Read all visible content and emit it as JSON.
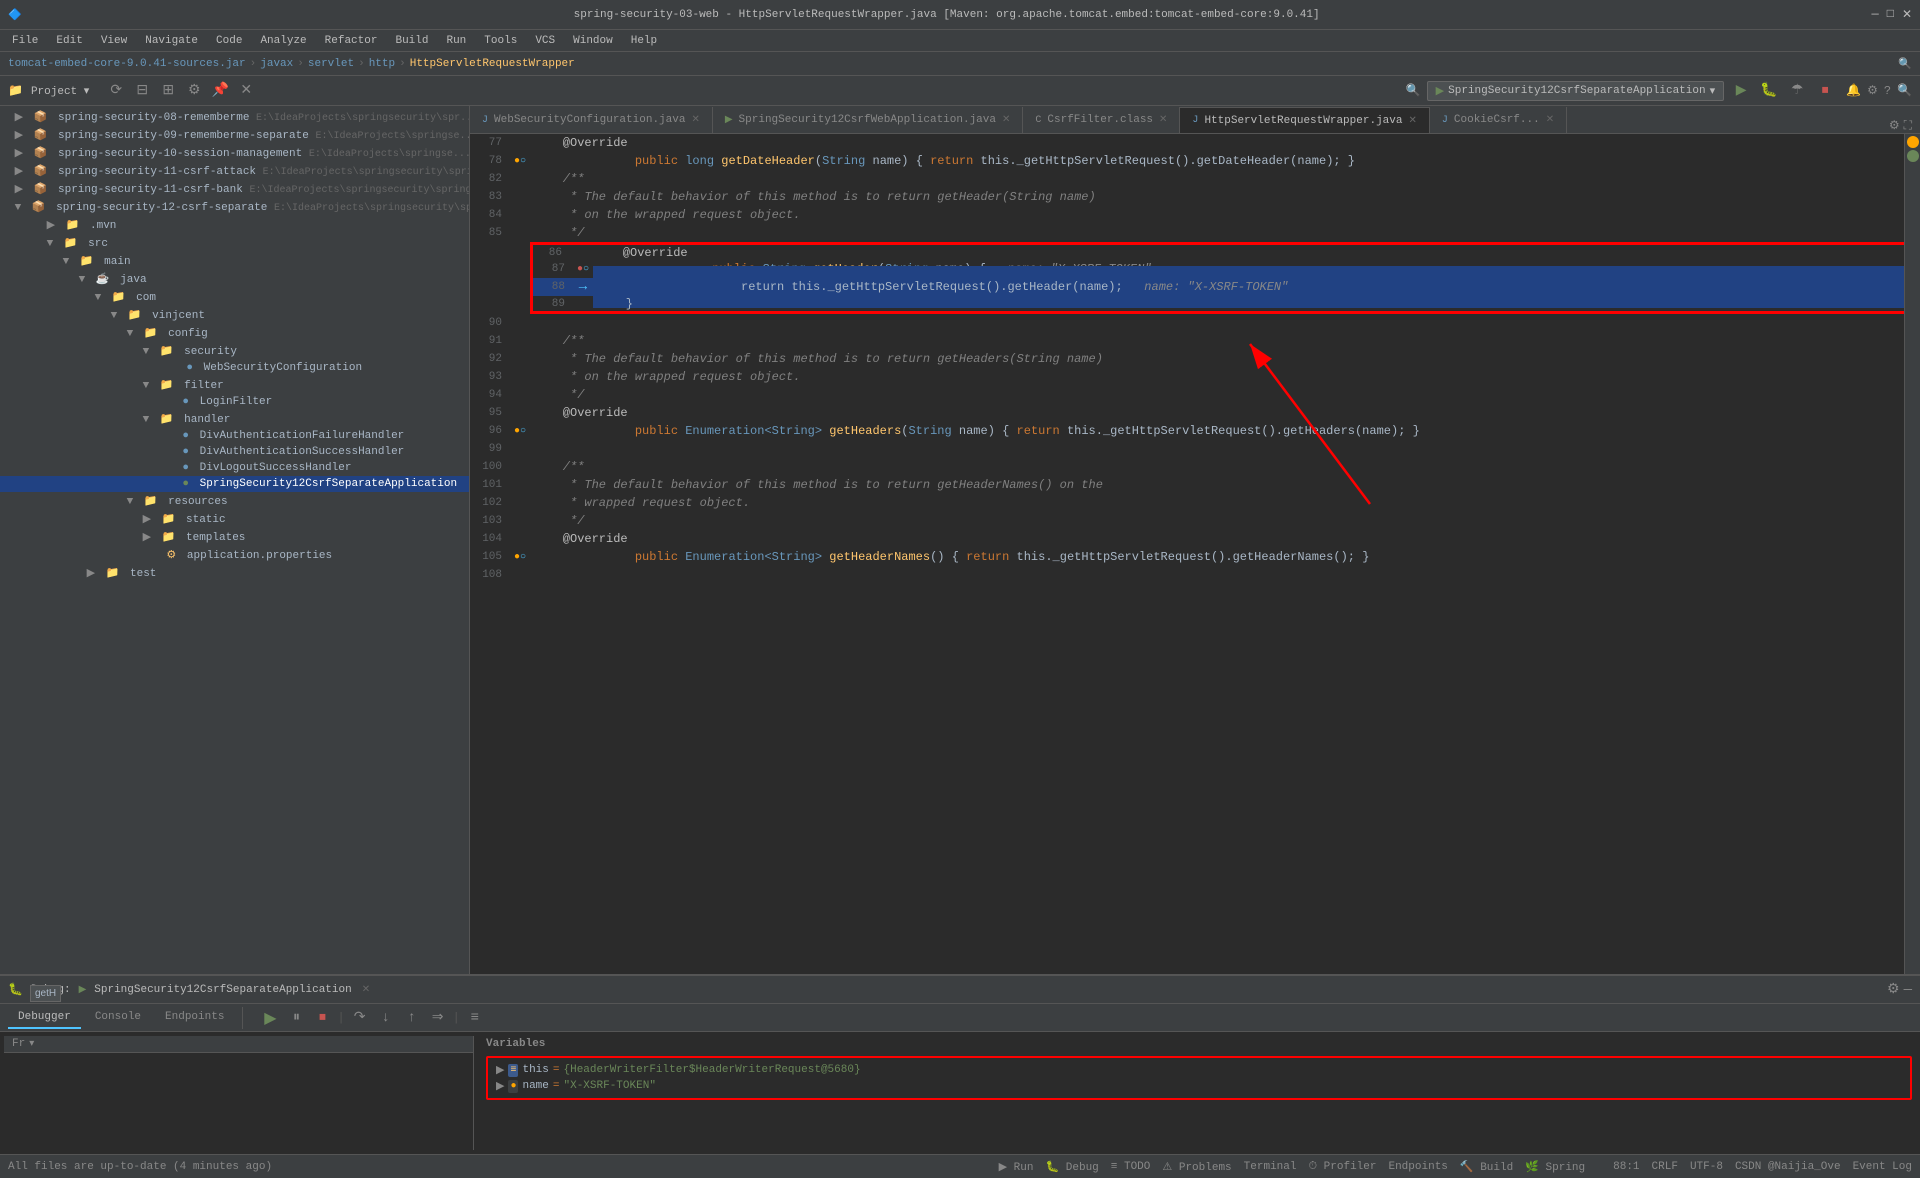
{
  "titlebar": {
    "title": "spring-security-03-web - HttpServletRequestWrapper.java [Maven: org.apache.tomcat.embed:tomcat-embed-core:9.0.41]",
    "controls": [
      "—",
      "□",
      "✕"
    ]
  },
  "menubar": {
    "items": [
      "File",
      "Edit",
      "View",
      "Navigate",
      "Code",
      "Analyze",
      "Refactor",
      "Build",
      "Run",
      "Tools",
      "VCS",
      "Window",
      "Help"
    ]
  },
  "breadcrumb": {
    "items": [
      "tomcat-embed-core-9.0.41-sources.jar",
      "javax",
      "servlet",
      "http",
      "HttpServletRequestWrapper"
    ]
  },
  "run_config": {
    "name": "SpringSecurity12CsrfSeparateApplication",
    "label": "SpringSecurity12CsrfSeparateApplication"
  },
  "editor_tabs": [
    {
      "label": "WebSecurityConfiguration.java",
      "active": false
    },
    {
      "label": "SpringSecurity12CsrfWebApplication.java",
      "active": false
    },
    {
      "label": "CsrfFilter.class",
      "active": false
    },
    {
      "label": "HttpServletRequestWrapper.java",
      "active": true
    },
    {
      "label": "CookieCsrf...",
      "active": false
    }
  ],
  "code_lines": [
    {
      "num": 77,
      "content": "    @Override",
      "type": "annotation"
    },
    {
      "num": 78,
      "content": "    public long getDateHeader(String name) { return this._getHttpServletRequest().getDateHeader(name); }",
      "type": "normal",
      "has_debug": true
    },
    {
      "num": 82,
      "content": "    /**",
      "type": "comment"
    },
    {
      "num": 83,
      "content": "     * The default behavior of this method is to return getHeader(String name)",
      "type": "comment"
    },
    {
      "num": 84,
      "content": "     * on the wrapped request object.",
      "type": "comment"
    },
    {
      "num": 85,
      "content": "     */",
      "type": "comment"
    },
    {
      "num": 86,
      "content": "    @Override",
      "type": "annotation"
    },
    {
      "num": 87,
      "content": "    public String getHeader(String name) {   name: \"X-XSRF-TOKEN\"",
      "type": "normal",
      "has_debug": true,
      "has_breakpoint": true
    },
    {
      "num": 88,
      "content": "        return this._getHttpServletRequest().getHeader(name);   name: \"X-XSRF-TOKEN\"",
      "type": "normal",
      "highlighted": true,
      "has_debug": true
    },
    {
      "num": 89,
      "content": "    }",
      "type": "normal"
    },
    {
      "num": 90,
      "content": "",
      "type": "normal"
    },
    {
      "num": 91,
      "content": "    /**",
      "type": "comment"
    },
    {
      "num": 92,
      "content": "     * The default behavior of this method is to return getHeaders(String name)",
      "type": "comment"
    },
    {
      "num": 93,
      "content": "     * on the wrapped request object.",
      "type": "comment"
    },
    {
      "num": 94,
      "content": "     */",
      "type": "comment"
    },
    {
      "num": 95,
      "content": "    @Override",
      "type": "annotation"
    },
    {
      "num": 96,
      "content": "    public Enumeration<String> getHeaders(String name) { return this._getHttpServletRequest().getHeaders(name); }",
      "type": "normal",
      "has_debug": true,
      "has_breakpoint": true
    },
    {
      "num": 99,
      "content": "",
      "type": "normal"
    },
    {
      "num": 100,
      "content": "    /**",
      "type": "comment"
    },
    {
      "num": 101,
      "content": "     * The default behavior of this method is to return getHeaderNames() on the",
      "type": "comment"
    },
    {
      "num": 102,
      "content": "     * wrapped request object.",
      "type": "comment"
    },
    {
      "num": 103,
      "content": "     */",
      "type": "comment"
    },
    {
      "num": 104,
      "content": "    @Override",
      "type": "annotation"
    },
    {
      "num": 105,
      "content": "    public Enumeration<String> getHeaderNames() { return this._getHttpServletRequest().getHeaderNames(); }",
      "type": "normal",
      "has_debug": true,
      "has_breakpoint": true
    },
    {
      "num": 108,
      "content": "",
      "type": "normal"
    }
  ],
  "project_panel": {
    "title": "Project",
    "items": [
      {
        "label": "spring-security-08-rememberme",
        "path": "E:\\IdeaProjects\\springsecurity\\spr...",
        "indent": 1,
        "type": "module"
      },
      {
        "label": "spring-security-09-rememberme-separate",
        "path": "E:\\IdeaProjects\\springse...",
        "indent": 1,
        "type": "module"
      },
      {
        "label": "spring-security-10-session-management",
        "path": "E:\\IdeaProjects\\springse...",
        "indent": 1,
        "type": "module"
      },
      {
        "label": "spring-security-11-csrf-attack",
        "path": "E:\\IdeaProjects\\springsecurity\\spring...",
        "indent": 1,
        "type": "module"
      },
      {
        "label": "spring-security-11-csrf-bank",
        "path": "E:\\IdeaProjects\\springsecurity\\spring-s...",
        "indent": 1,
        "type": "module"
      },
      {
        "label": "spring-security-12-csrf-separate",
        "path": "E:\\IdeaProjects\\springsecurity\\spri...",
        "indent": 1,
        "type": "module",
        "expanded": true
      },
      {
        "label": ".mvn",
        "indent": 3,
        "type": "folder"
      },
      {
        "label": "src",
        "indent": 3,
        "type": "folder",
        "expanded": true
      },
      {
        "label": "main",
        "indent": 4,
        "type": "folder",
        "expanded": true
      },
      {
        "label": "java",
        "indent": 5,
        "type": "folder",
        "expanded": true
      },
      {
        "label": "com",
        "indent": 6,
        "type": "folder",
        "expanded": true
      },
      {
        "label": "vinjcent",
        "indent": 7,
        "type": "folder",
        "expanded": true
      },
      {
        "label": "config",
        "indent": 8,
        "type": "folder",
        "expanded": true
      },
      {
        "label": "security",
        "indent": 9,
        "type": "folder",
        "expanded": true
      },
      {
        "label": "WebSecurityConfiguration",
        "indent": 10,
        "type": "java"
      },
      {
        "label": "filter",
        "indent": 9,
        "type": "folder",
        "expanded": true
      },
      {
        "label": "LoginFilter",
        "indent": 10,
        "type": "java"
      },
      {
        "label": "handler",
        "indent": 9,
        "type": "folder",
        "expanded": true
      },
      {
        "label": "DivAuthenticationFailureHandler",
        "indent": 10,
        "type": "java"
      },
      {
        "label": "DivAuthenticationSuccessHandler",
        "indent": 10,
        "type": "java"
      },
      {
        "label": "DivLogoutSuccessHandler",
        "indent": 10,
        "type": "java"
      },
      {
        "label": "SpringSecurity12CsrfSeparateApplication",
        "indent": 10,
        "type": "java",
        "selected": true
      },
      {
        "label": "resources",
        "indent": 8,
        "type": "folder",
        "expanded": true
      },
      {
        "label": "static",
        "indent": 9,
        "type": "folder"
      },
      {
        "label": "templates",
        "indent": 9,
        "type": "folder"
      },
      {
        "label": "application.properties",
        "indent": 9,
        "type": "properties"
      },
      {
        "label": "test",
        "indent": 6,
        "type": "folder"
      }
    ]
  },
  "debug_panel": {
    "title": "Debug:",
    "app_name": "SpringSecurity12CsrfSeparateApplication",
    "tabs": [
      "Debugger",
      "Console",
      "Endpoints"
    ],
    "variables_label": "Variables",
    "variables": [
      {
        "name": "this",
        "value": "{HeaderWriterFilter$HeaderWriterRequest@5680}",
        "expanded": false,
        "type": "obj"
      },
      {
        "name": "name",
        "value": "\"X-XSRF-TOKEN\"",
        "expanded": false,
        "type": "str"
      }
    ]
  },
  "status_bar": {
    "message": "All files are up-to-date (4 minutes ago)",
    "position": "88:1",
    "encoding": "CRLF",
    "charset": "UTF-8",
    "git_info": "CSDN @Naijia_Ove"
  },
  "bottom_run_tabs": [
    {
      "label": "▶ Run",
      "icon": "run"
    },
    {
      "label": "☰ Debug",
      "icon": "debug"
    },
    {
      "label": "≡ TODO",
      "icon": "todo"
    },
    {
      "label": "⚠ Problems",
      "icon": "problems"
    },
    {
      "label": "Terminal",
      "icon": "terminal"
    },
    {
      "label": "⏱ Profiler",
      "icon": "profiler"
    },
    {
      "label": "Endpoints",
      "icon": "endpoints"
    },
    {
      "label": "🔨 Build",
      "icon": "build"
    },
    {
      "label": "🌿 Spring",
      "icon": "spring"
    }
  ]
}
